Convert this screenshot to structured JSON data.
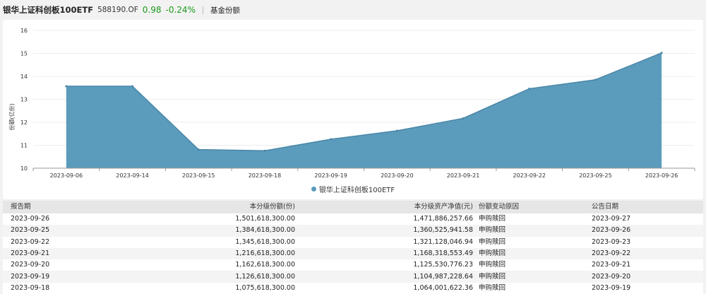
{
  "header": {
    "fund_name": "银华上证科创板100ETF",
    "code": "588190.OF",
    "price": "0.98",
    "change": "-0.24%",
    "tab": "基金份额",
    "colors": {
      "price": "#1a9a1a",
      "change": "#1a9a1a"
    }
  },
  "chart_data": {
    "type": "area",
    "ylabel": "份额(亿份)",
    "ylim": [
      10,
      16
    ],
    "yticks": [
      "10",
      "11",
      "12",
      "13",
      "14",
      "15",
      "16"
    ],
    "x": [
      "2023-09-06",
      "2023-09-14",
      "2023-09-15",
      "2023-09-18",
      "2023-09-19",
      "2023-09-20",
      "2023-09-21",
      "2023-09-22",
      "2023-09-25",
      "2023-09-26"
    ],
    "series": [
      {
        "name": "银华上证科创板100ETF",
        "values": [
          13.57,
          13.57,
          10.81,
          10.76,
          11.26,
          11.63,
          12.17,
          13.46,
          13.85,
          15.02
        ],
        "color": "#5b9bbc"
      }
    ],
    "grid": true,
    "legend": "bottom-center"
  },
  "table": {
    "columns": [
      "报告期",
      "本分级份额(份)",
      "本分级资产净值(元)",
      "份额变动原因",
      "公告日期"
    ],
    "rows": [
      [
        "2023-09-26",
        "1,501,618,300.00",
        "1,471,886,257.66",
        "申购赎回",
        "2023-09-27"
      ],
      [
        "2023-09-25",
        "1,384,618,300.00",
        "1,360,525,941.58",
        "申购赎回",
        "2023-09-26"
      ],
      [
        "2023-09-22",
        "1,345,618,300.00",
        "1,321,128,046.94",
        "申购赎回",
        "2023-09-23"
      ],
      [
        "2023-09-21",
        "1,216,618,300.00",
        "1,168,318,553.49",
        "申购赎回",
        "2023-09-22"
      ],
      [
        "2023-09-20",
        "1,162,618,300.00",
        "1,125,530,776.23",
        "申购赎回",
        "2023-09-21"
      ],
      [
        "2023-09-19",
        "1,126,618,300.00",
        "1,104,987,228.64",
        "申购赎回",
        "2023-09-20"
      ],
      [
        "2023-09-18",
        "1,075,618,300.00",
        "1,064,001,622.36",
        "申购赎回",
        "2023-09-19"
      ]
    ]
  }
}
